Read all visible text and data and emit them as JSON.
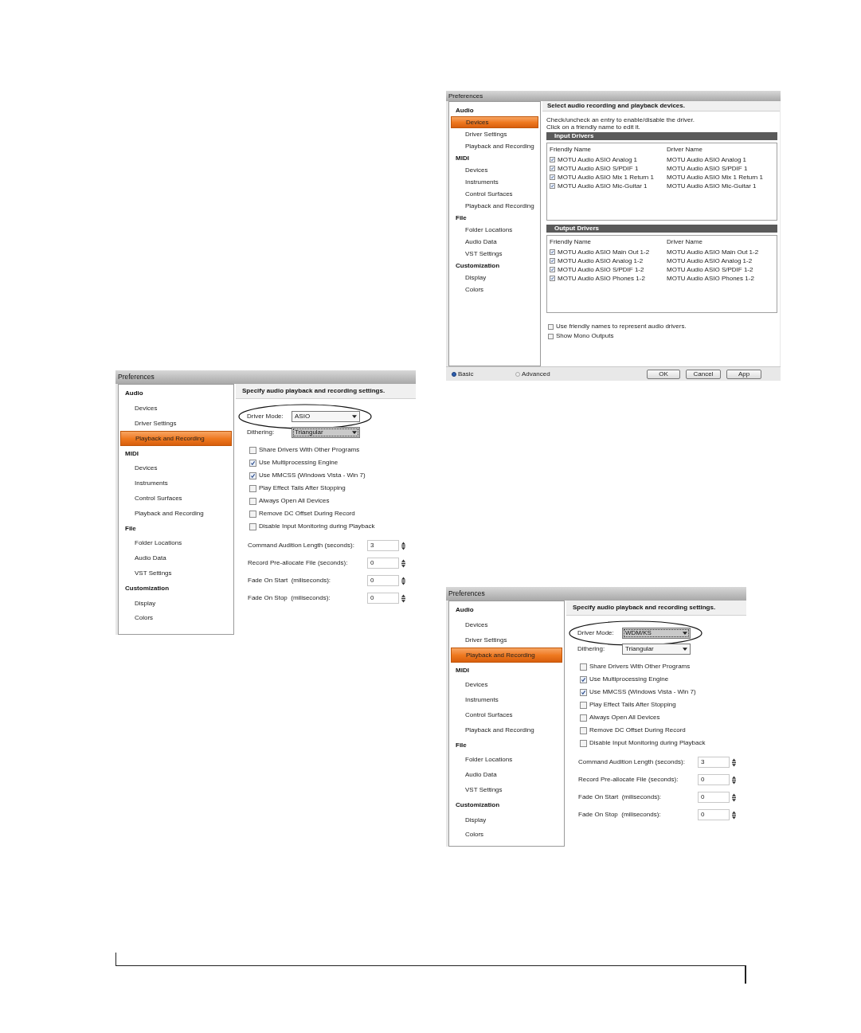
{
  "devices_window": {
    "title": "Preferences",
    "sidebar": [
      {
        "heading": "Audio",
        "items": [
          {
            "label": "Devices",
            "selected": true
          },
          {
            "label": "Driver Settings",
            "selected": false
          },
          {
            "label": "Playback and Recording",
            "selected": false
          }
        ]
      },
      {
        "heading": "MIDI",
        "items": [
          {
            "label": "Devices",
            "selected": false
          },
          {
            "label": "Instruments",
            "selected": false
          },
          {
            "label": "Control Surfaces",
            "selected": false
          },
          {
            "label": "Playback and Recording",
            "selected": false
          }
        ]
      },
      {
        "heading": "File",
        "items": [
          {
            "label": "Folder Locations",
            "selected": false
          },
          {
            "label": "Audio Data",
            "selected": false
          },
          {
            "label": "VST Settings",
            "selected": false
          }
        ]
      },
      {
        "heading": "Customization",
        "items": [
          {
            "label": "Display",
            "selected": false
          },
          {
            "label": "Colors",
            "selected": false
          }
        ]
      }
    ],
    "header": "Select audio recording and playback devices.",
    "instructions": [
      "Check/uncheck an entry to enable/disable the driver.",
      "Click on a friendly name to edit it."
    ],
    "driver_groups": [
      {
        "title": "Input Drivers",
        "columns": [
          "Friendly Name",
          "Driver Name"
        ],
        "rows": [
          {
            "friendly_name": "MOTU Audio ASIO Analog 1",
            "driver_name": "MOTU Audio ASIO Analog 1",
            "checked": true
          },
          {
            "friendly_name": "MOTU Audio ASIO S/PDIF 1",
            "driver_name": "MOTU Audio ASIO S/PDIF 1",
            "checked": true
          },
          {
            "friendly_name": "MOTU Audio ASIO Mix 1 Return 1",
            "driver_name": "MOTU Audio ASIO Mix 1 Return 1",
            "checked": true
          },
          {
            "friendly_name": "MOTU Audio ASIO Mic-Guitar 1",
            "driver_name": "MOTU Audio ASIO Mic-Guitar 1",
            "checked": true
          }
        ]
      },
      {
        "title": "Output Drivers",
        "columns": [
          "Friendly Name",
          "Driver Name"
        ],
        "rows": [
          {
            "friendly_name": "MOTU Audio ASIO Main Out 1-2",
            "driver_name": "MOTU Audio ASIO Main Out 1-2",
            "checked": true
          },
          {
            "friendly_name": "MOTU Audio ASIO Analog 1-2",
            "driver_name": "MOTU Audio ASIO Analog 1-2",
            "checked": true
          },
          {
            "friendly_name": "MOTU Audio ASIO S/PDIF 1-2",
            "driver_name": "MOTU Audio ASIO S/PDIF 1-2",
            "checked": true
          },
          {
            "friendly_name": "MOTU Audio ASIO Phones 1-2",
            "driver_name": "MOTU Audio ASIO Phones 1-2",
            "checked": true
          }
        ]
      }
    ],
    "options": [
      {
        "label": "Use friendly names to represent audio drivers.",
        "checked": false
      },
      {
        "label": "Show Mono Outputs",
        "checked": false
      }
    ],
    "modes": [
      {
        "label": "Basic",
        "selected": true
      },
      {
        "label": "Advanced",
        "selected": false
      }
    ],
    "buttons": [
      "OK",
      "Cancel",
      "App"
    ]
  },
  "asio_window": {
    "title": "Preferences",
    "sidebar": [
      {
        "heading": "Audio",
        "items": [
          {
            "label": "Devices",
            "selected": false
          },
          {
            "label": "Driver Settings",
            "selected": false
          },
          {
            "label": "Playback and Recording",
            "selected": true
          }
        ]
      },
      {
        "heading": "MIDI",
        "items": [
          {
            "label": "Devices",
            "selected": false
          },
          {
            "label": "Instruments",
            "selected": false
          },
          {
            "label": "Control Surfaces",
            "selected": false
          },
          {
            "label": "Playback and Recording",
            "selected": false
          }
        ]
      },
      {
        "heading": "File",
        "items": [
          {
            "label": "Folder Locations",
            "selected": false
          },
          {
            "label": "Audio Data",
            "selected": false
          },
          {
            "label": "VST Settings",
            "selected": false
          }
        ]
      },
      {
        "heading": "Customization",
        "items": [
          {
            "label": "Display",
            "selected": false
          },
          {
            "label": "Colors",
            "selected": false
          }
        ]
      }
    ],
    "header": "Specify audio playback and recording settings.",
    "dropdowns": [
      {
        "label": "Driver Mode:",
        "value": "ASIO",
        "circled": true,
        "focused": false
      },
      {
        "label": "Dithering:",
        "value": "Triangular",
        "focused": true
      }
    ],
    "checkboxes": [
      {
        "label": "Share Drivers With Other Programs",
        "checked": false
      },
      {
        "label": "Use Multiprocessing Engine",
        "checked": true
      },
      {
        "label": "Use MMCSS (Windows Vista - Win 7)",
        "checked": true
      },
      {
        "label": "Play Effect Tails After Stopping",
        "checked": false
      },
      {
        "label": "Always Open All Devices",
        "checked": false
      },
      {
        "label": "Remove DC Offset During Record",
        "checked": false
      },
      {
        "label": "Disable Input Monitoring during Playback",
        "checked": false
      }
    ],
    "spin_fields": [
      {
        "label": "Command Audition Length (seconds):",
        "value": "3"
      },
      {
        "label": "Record Pre-allocate File (seconds):",
        "value": "0"
      },
      {
        "label": "Fade On Start  (miliseconds):",
        "value": "0"
      },
      {
        "label": "Fade On Stop  (miliseconds):",
        "value": "0"
      }
    ]
  },
  "wdm_window": {
    "title": "Preferences",
    "sidebar": [
      {
        "heading": "Audio",
        "items": [
          {
            "label": "Devices",
            "selected": false
          },
          {
            "label": "Driver Settings",
            "selected": false
          },
          {
            "label": "Playback and Recording",
            "selected": true
          }
        ]
      },
      {
        "heading": "MIDI",
        "items": [
          {
            "label": "Devices",
            "selected": false
          },
          {
            "label": "Instruments",
            "selected": false
          },
          {
            "label": "Control Surfaces",
            "selected": false
          },
          {
            "label": "Playback and Recording",
            "selected": false
          }
        ]
      },
      {
        "heading": "File",
        "items": [
          {
            "label": "Folder Locations",
            "selected": false
          },
          {
            "label": "Audio Data",
            "selected": false
          },
          {
            "label": "VST Settings",
            "selected": false
          }
        ]
      },
      {
        "heading": "Customization",
        "items": [
          {
            "label": "Display",
            "selected": false
          },
          {
            "label": "Colors",
            "selected": false
          }
        ]
      }
    ],
    "header": "Specify audio playback and recording settings.",
    "dropdowns": [
      {
        "label": "Driver Mode:",
        "value": "WDM/KS",
        "circled": true,
        "focused": true
      },
      {
        "label": "Dithering:",
        "value": "Triangular",
        "focused": false
      }
    ],
    "checkboxes": [
      {
        "label": "Share Drivers With Other Programs",
        "checked": false
      },
      {
        "label": "Use Multiprocessing Engine",
        "checked": true
      },
      {
        "label": "Use MMCSS (Windows Vista - Win 7)",
        "checked": true
      },
      {
        "label": "Play Effect Tails After Stopping",
        "checked": false
      },
      {
        "label": "Always Open All Devices",
        "checked": false
      },
      {
        "label": "Remove DC Offset During Record",
        "checked": false
      },
      {
        "label": "Disable Input Monitoring during Playback",
        "checked": false
      }
    ],
    "spin_fields": [
      {
        "label": "Command Audition Length (seconds):",
        "value": "3"
      },
      {
        "label": "Record Pre-allocate File (seconds):",
        "value": "0"
      },
      {
        "label": "Fade On Start  (miliseconds):",
        "value": "0"
      },
      {
        "label": "Fade On Stop  (miliseconds):",
        "value": "0"
      }
    ]
  }
}
